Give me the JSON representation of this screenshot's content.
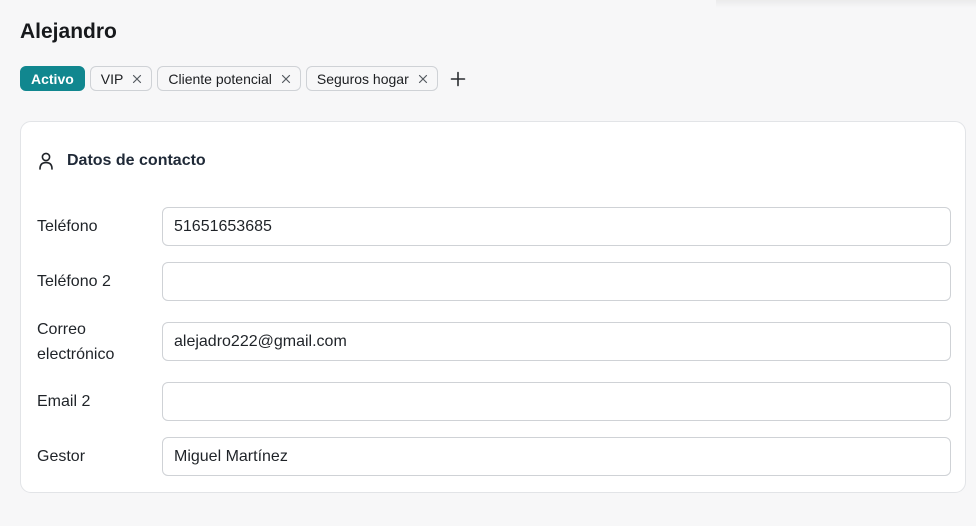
{
  "contact": {
    "name": "Alejandro"
  },
  "tags": {
    "status": "Activo",
    "items": [
      "VIP",
      "Cliente potencial",
      "Seguros hogar"
    ]
  },
  "section": {
    "title": "Datos de contacto",
    "fields": {
      "phone": {
        "label": "Teléfono",
        "value": "51651653685"
      },
      "phone2": {
        "label": "Teléfono 2",
        "value": ""
      },
      "email": {
        "label_line1": "Correo",
        "label_line2": "electrónico",
        "value": "alejadro222@gmail.com"
      },
      "email2": {
        "label": "Email 2",
        "value": ""
      },
      "manager": {
        "label": "Gestor",
        "value": "Miguel Martínez"
      }
    }
  },
  "colors": {
    "status_tag": "#11878f",
    "border": "#cfd2d6"
  },
  "icons": {
    "section": "user-icon",
    "tag_remove": "close-icon",
    "add_tag": "plus-icon"
  }
}
